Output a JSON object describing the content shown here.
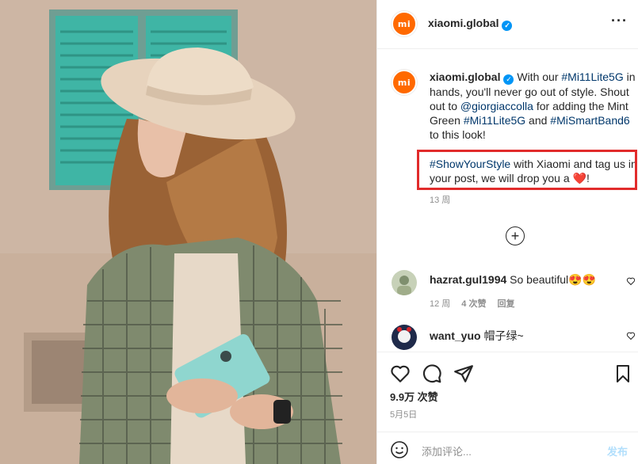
{
  "post": {
    "username": "xiaomi.global",
    "avatar_text": "mi",
    "caption": {
      "username": "xiaomi.global",
      "p1_a": " With our ",
      "tag1": "#Mi11Lite5G",
      "p1_b": " in hands, you'll never go out of style. Shout out to ",
      "mention": "@giorgiaccolla",
      "p1_c": " for adding the Mint Green ",
      "tag2": "#Mi11Lite5G",
      "p1_d": " and ",
      "tag3": "#MiSmartBand6",
      "p1_e": " to this look!",
      "tag4": "#ShowYourStyle",
      "p2_a": " with Xiaomi and tag us in your post, we will drop you a ",
      "emoji": "❤️",
      "p2_b": "!",
      "time": "13 周"
    },
    "load_more": "+",
    "comments": [
      {
        "username": "hazrat.gul1994",
        "text": " So beautiful😍😍",
        "time": "12 周",
        "likes": "4 次赞",
        "reply": "回复"
      },
      {
        "username": "want_yuo",
        "text": " 帽子绿~"
      }
    ],
    "likes_count": "9.9万 次赞",
    "date": "5月5日",
    "add_comment_placeholder": "添加评论...",
    "post_button": "发布"
  },
  "colors": {
    "brand": "#ff6900",
    "verified": "#0095f6",
    "hashtag": "#00376b",
    "highlight_box": "#e12b2b"
  },
  "icons": [
    "more-icon",
    "verified-icon",
    "add-icon",
    "heart-icon",
    "comment-icon",
    "share-icon",
    "bookmark-icon",
    "emoji-icon"
  ]
}
